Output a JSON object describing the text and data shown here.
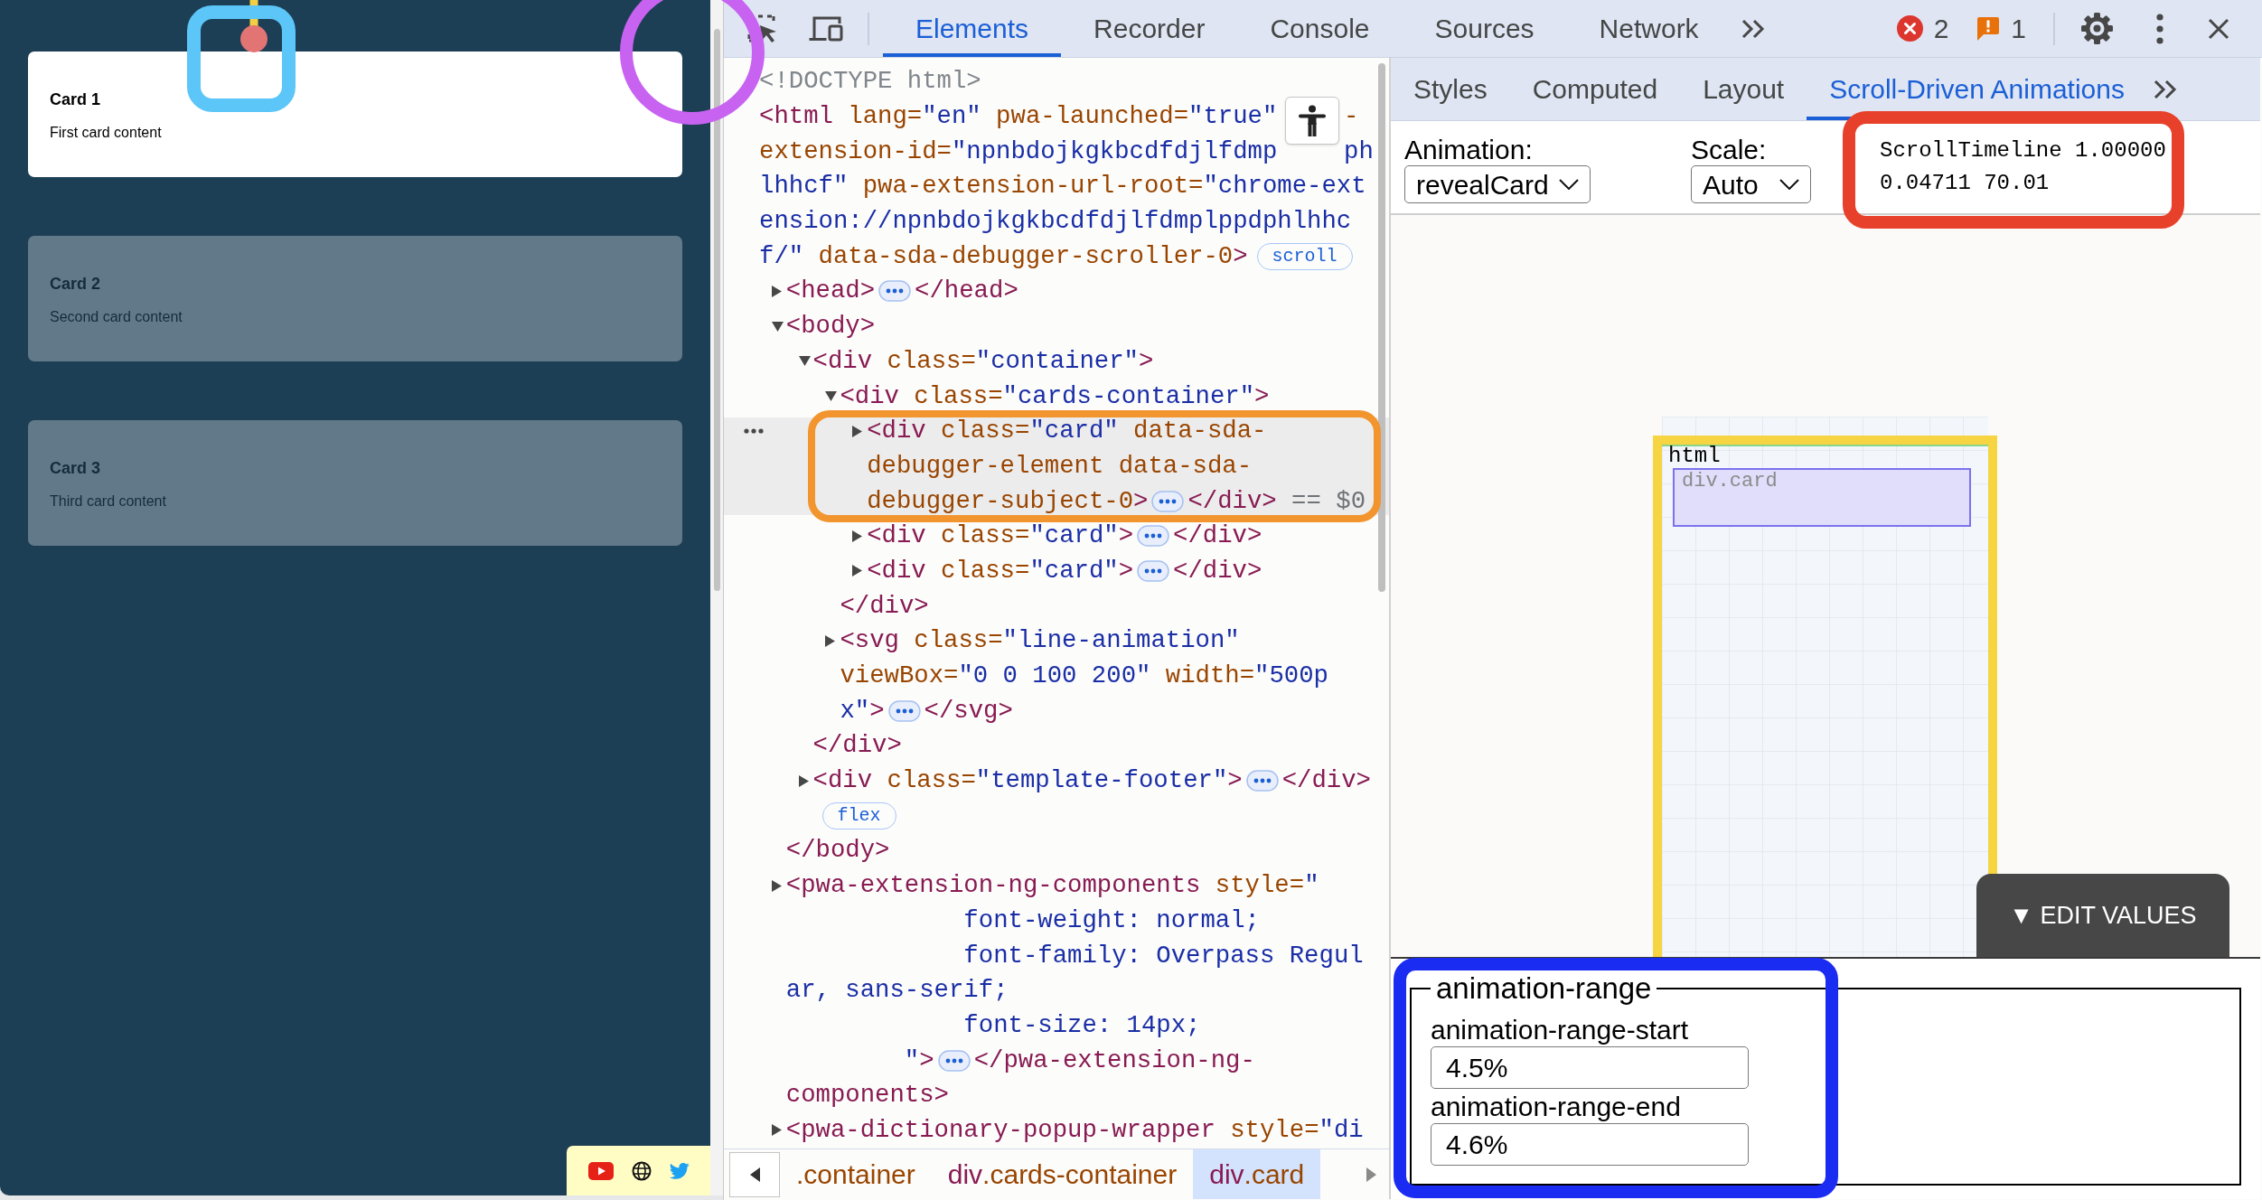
{
  "page": {
    "cards": [
      {
        "title": "Card 1",
        "text": "First card content",
        "revealed": true
      },
      {
        "title": "Card 2",
        "text": "Second card content",
        "revealed": false
      },
      {
        "title": "Card 3",
        "text": "Third card content",
        "revealed": false
      }
    ]
  },
  "devtools": {
    "main_tabs": [
      {
        "label": "Elements",
        "selected": true
      },
      {
        "label": "Recorder",
        "selected": false
      },
      {
        "label": "Console",
        "selected": false
      },
      {
        "label": "Sources",
        "selected": false
      },
      {
        "label": "Network",
        "selected": false
      }
    ],
    "issues": [
      {
        "kind": "error",
        "count": "2"
      },
      {
        "kind": "warning",
        "count": "1"
      }
    ],
    "dom_tree": [
      {
        "selected": false,
        "lines": [
          {
            "tokens": [
              {
                "kind": "doctype",
                "text": "<!DOCTYPE html>"
              }
            ]
          }
        ]
      },
      {
        "selected": false,
        "lines": [
          {
            "tokens": [
              {
                "kind": "tag",
                "text": "<html"
              },
              {
                "kind": "attr",
                "text": " lang="
              },
              {
                "kind": "value",
                "text": "\"en\""
              },
              {
                "kind": "attr",
                "text": " pwa-launched="
              },
              {
                "kind": "value",
                "text": "\"true\""
              }
            ],
            "tail": [
              {
                "kind": "attr",
                "text": "-"
              }
            ]
          },
          {
            "tokens": [
              {
                "kind": "attr",
                "text": "extension-id="
              },
              {
                "kind": "value",
                "text": "\"npnbdojkgkbcdfdjlfdmp"
              }
            ],
            "tail": [
              {
                "kind": "value",
                "text": "ph"
              }
            ]
          },
          {
            "tokens": [
              {
                "kind": "value",
                "text": "lhhcf\""
              },
              {
                "kind": "attr",
                "text": " pwa-extension-url-root="
              },
              {
                "kind": "value",
                "text": "\"chrome-ext"
              }
            ]
          },
          {
            "tokens": [
              {
                "kind": "value",
                "text": "ension://npnbdojkgkbcdfdjlfdmplppdphlhhc"
              }
            ]
          },
          {
            "tokens": [
              {
                "kind": "value",
                "text": "f/\""
              },
              {
                "kind": "attr",
                "text": " data-sda-debugger-scroller-0"
              },
              {
                "kind": "tag",
                "text": ">"
              },
              {
                "kind": "badge",
                "text": "scroll"
              }
            ]
          }
        ],
        "children": [
          {
            "selected": false,
            "expanded": false,
            "lines": [
              {
                "tokens": [
                  {
                    "kind": "tag",
                    "text": "<head>"
                  },
                  {
                    "kind": "more"
                  },
                  {
                    "kind": "tag",
                    "text": "</head>"
                  }
                ]
              }
            ]
          },
          {
            "selected": false,
            "expanded": true,
            "lines": [
              {
                "tokens": [
                  {
                    "kind": "tag",
                    "text": "<body>"
                  }
                ]
              }
            ],
            "children": [
              {
                "selected": false,
                "expanded": true,
                "lines": [
                  {
                    "tokens": [
                      {
                        "kind": "tag",
                        "text": "<div"
                      },
                      {
                        "kind": "attr",
                        "text": " class="
                      },
                      {
                        "kind": "value",
                        "text": "\"container\""
                      },
                      {
                        "kind": "tag",
                        "text": ">"
                      }
                    ]
                  }
                ],
                "children": [
                  {
                    "selected": false,
                    "expanded": true,
                    "lines": [
                      {
                        "tokens": [
                          {
                            "kind": "tag",
                            "text": "<div"
                          },
                          {
                            "kind": "attr",
                            "text": " class="
                          },
                          {
                            "kind": "value",
                            "text": "\"cards-container\""
                          },
                          {
                            "kind": "tag",
                            "text": ">"
                          }
                        ]
                      }
                    ],
                    "children": [
                      {
                        "selected": true,
                        "expanded": false,
                        "lines": [
                          {
                            "tokens": [
                              {
                                "kind": "tag",
                                "text": "<div"
                              },
                              {
                                "kind": "attr",
                                "text": " class="
                              },
                              {
                                "kind": "value",
                                "text": "\"card\""
                              },
                              {
                                "kind": "attr",
                                "text": " data-sda-"
                              }
                            ]
                          },
                          {
                            "tokens": [
                              {
                                "kind": "attr",
                                "text": "debugger-element data-sda-"
                              }
                            ]
                          },
                          {
                            "tokens": [
                              {
                                "kind": "attr",
                                "text": "debugger-subject-0"
                              },
                              {
                                "kind": "tag",
                                "text": ">"
                              },
                              {
                                "kind": "more"
                              },
                              {
                                "kind": "tag",
                                "text": "</div>"
                              },
                              {
                                "kind": "marker",
                                "text": " == $0"
                              }
                            ]
                          }
                        ]
                      },
                      {
                        "selected": false,
                        "expanded": false,
                        "lines": [
                          {
                            "tokens": [
                              {
                                "kind": "tag",
                                "text": "<div"
                              },
                              {
                                "kind": "attr",
                                "text": " class="
                              },
                              {
                                "kind": "value",
                                "text": "\"card\""
                              },
                              {
                                "kind": "tag",
                                "text": ">"
                              },
                              {
                                "kind": "more"
                              },
                              {
                                "kind": "tag",
                                "text": "</div>"
                              }
                            ]
                          }
                        ]
                      },
                      {
                        "selected": false,
                        "expanded": false,
                        "lines": [
                          {
                            "tokens": [
                              {
                                "kind": "tag",
                                "text": "<div"
                              },
                              {
                                "kind": "attr",
                                "text": " class="
                              },
                              {
                                "kind": "value",
                                "text": "\"card\""
                              },
                              {
                                "kind": "tag",
                                "text": ">"
                              },
                              {
                                "kind": "more"
                              },
                              {
                                "kind": "tag",
                                "text": "</div>"
                              }
                            ]
                          }
                        ]
                      }
                    ],
                    "close": [
                      {
                        "kind": "tag",
                        "text": "</div>"
                      }
                    ]
                  },
                  {
                    "selected": false,
                    "expanded": false,
                    "lines": [
                      {
                        "tokens": [
                          {
                            "kind": "tag",
                            "text": "<svg"
                          },
                          {
                            "kind": "attr",
                            "text": " class="
                          },
                          {
                            "kind": "value",
                            "text": "\"line-animation\""
                          }
                        ]
                      },
                      {
                        "tokens": [
                          {
                            "kind": "attr",
                            "text": "viewBox="
                          },
                          {
                            "kind": "value",
                            "text": "\"0 0 100 200\""
                          },
                          {
                            "kind": "attr",
                            "text": " width="
                          },
                          {
                            "kind": "value",
                            "text": "\"500p"
                          }
                        ]
                      },
                      {
                        "tokens": [
                          {
                            "kind": "value",
                            "text": "x\""
                          },
                          {
                            "kind": "tag",
                            "text": ">"
                          },
                          {
                            "kind": "more"
                          },
                          {
                            "kind": "tag",
                            "text": "</svg>"
                          }
                        ]
                      }
                    ]
                  }
                ],
                "close": [
                  {
                    "kind": "tag",
                    "text": "</div>"
                  }
                ]
              },
              {
                "selected": false,
                "expanded": false,
                "lines": [
                  {
                    "tokens": [
                      {
                        "kind": "tag",
                        "text": "<div"
                      },
                      {
                        "kind": "attr",
                        "text": " class="
                      },
                      {
                        "kind": "value",
                        "text": "\"template-footer\""
                      },
                      {
                        "kind": "tag",
                        "text": ">"
                      },
                      {
                        "kind": "more"
                      },
                      {
                        "kind": "tag",
                        "text": "</div>"
                      }
                    ]
                  },
                  {
                    "tokens": [
                      {
                        "kind": "badge",
                        "text": "flex"
                      }
                    ]
                  }
                ]
              }
            ],
            "close": [
              {
                "kind": "tag",
                "text": "</body>"
              }
            ]
          },
          {
            "selected": false,
            "expanded": false,
            "lines": [
              {
                "tokens": [
                  {
                    "kind": "tag",
                    "text": "<pwa-extension-ng-components"
                  },
                  {
                    "kind": "attr",
                    "text": " style="
                  },
                  {
                    "kind": "value",
                    "text": "\""
                  }
                ]
              },
              {
                "tokens": [
                  {
                    "kind": "value",
                    "text": "            font-weight: normal;"
                  }
                ]
              },
              {
                "tokens": [
                  {
                    "kind": "value",
                    "text": "            font-family: Overpass Regul"
                  }
                ]
              },
              {
                "tokens": [
                  {
                    "kind": "value",
                    "text": "ar, sans-serif;"
                  }
                ]
              },
              {
                "tokens": [
                  {
                    "kind": "value",
                    "text": "            font-size: 14px;"
                  }
                ]
              },
              {
                "tokens": [
                  {
                    "kind": "value",
                    "text": "        \""
                  },
                  {
                    "kind": "tag",
                    "text": ">"
                  },
                  {
                    "kind": "more"
                  },
                  {
                    "kind": "tag",
                    "text": "</pwa-extension-ng-"
                  }
                ]
              },
              {
                "tokens": [
                  {
                    "kind": "tag",
                    "text": "components>"
                  }
                ]
              }
            ]
          },
          {
            "selected": false,
            "expanded": false,
            "lines": [
              {
                "tokens": [
                  {
                    "kind": "tag",
                    "text": "<pwa-dictionary-popup-wrapper"
                  },
                  {
                    "kind": "attr",
                    "text": " style="
                  },
                  {
                    "kind": "value",
                    "text": "\"di"
                  }
                ]
              }
            ]
          }
        ]
      }
    ],
    "breadcrumbs": [
      {
        "selected": false,
        "parts": [
          {
            "kind": "attr",
            "text": ".container"
          }
        ]
      },
      {
        "selected": false,
        "parts": [
          {
            "kind": "tag",
            "text": "div"
          },
          {
            "kind": "attr",
            "text": ".cards-container"
          }
        ]
      },
      {
        "selected": true,
        "parts": [
          {
            "kind": "tag",
            "text": "div"
          },
          {
            "kind": "attr",
            "text": ".card"
          }
        ]
      }
    ],
    "sidebar_tabs": [
      {
        "label": "Styles",
        "selected": false
      },
      {
        "label": "Computed",
        "selected": false
      },
      {
        "label": "Layout",
        "selected": false
      },
      {
        "label": "Scroll-Driven Animations",
        "selected": true
      }
    ],
    "animation_select": {
      "label": "Animation:",
      "value": "revealCard"
    },
    "scale_select": {
      "label": "Scale:",
      "value": "Auto"
    },
    "timeline_readout": [
      "ScrollTimeline 1.00000",
      "0.04711 70.01"
    ],
    "visualizer": {
      "scroller_label": "html",
      "subject_label": "div.card"
    },
    "edit_values_button": "▼ EDIT VALUES",
    "animation_range": {
      "legend": "animation-range",
      "fields": [
        {
          "label": "animation-range-start",
          "value": "4.5%"
        },
        {
          "label": "animation-range-end",
          "value": "4.6%"
        }
      ]
    }
  }
}
